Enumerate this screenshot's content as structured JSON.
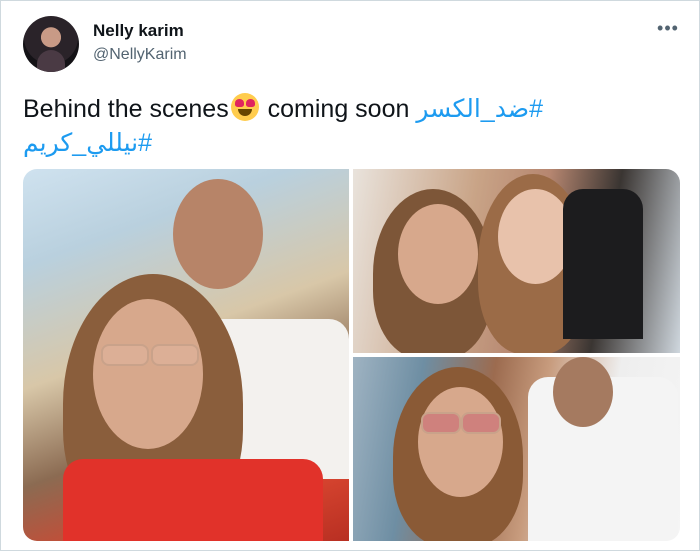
{
  "tweet": {
    "author": {
      "display_name": "Nelly karim",
      "handle": "@NellyKarim"
    },
    "more_icon": "more-horizontal-icon",
    "text_part1": "Behind the scenes",
    "emoji": "heart-eyes-emoji",
    "text_part2": " coming soon ",
    "hashtag1": "#ضد_الكسر",
    "hashtag2": "#نيللي_كريم"
  },
  "media": {
    "photos": [
      {
        "name": "photo-1",
        "desc_icon": "photo"
      },
      {
        "name": "photo-2",
        "desc_icon": "photo"
      },
      {
        "name": "photo-3",
        "desc_icon": "photo"
      }
    ]
  },
  "colors": {
    "hashtag": "#1d9bf0",
    "text": "#0f1419",
    "secondary": "#536471",
    "border": "#cfd9de"
  }
}
